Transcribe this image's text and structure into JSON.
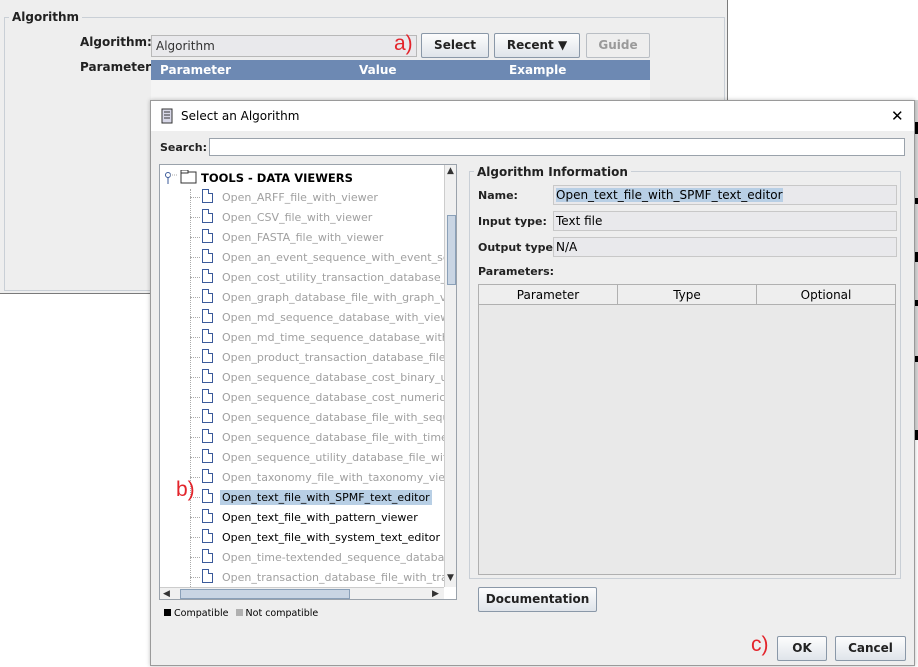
{
  "background_window": {
    "group_title": "Algorithm",
    "algorithm_label": "Algorithm:",
    "algorithm_value": "Algorithm",
    "parameters_label": "Parameters:",
    "select_button": "Select",
    "recent_button": "Recent",
    "guide_button": "Guide",
    "table_headers": [
      "Parameter",
      "Value",
      "Example"
    ]
  },
  "annotations": {
    "a": "a)",
    "b": "b)",
    "c": "c)"
  },
  "dialog": {
    "title": "Select an Algorithm",
    "close_glyph": "✕",
    "search_label": "Search:",
    "search_value": "",
    "tree": {
      "root_label": "TOOLS - DATA VIEWERS",
      "items": [
        {
          "label": "Open_ARFF_file_with_viewer",
          "compatible": false,
          "selected": false
        },
        {
          "label": "Open_CSV_file_with_viewer",
          "compatible": false,
          "selected": false
        },
        {
          "label": "Open_FASTA_file_with_viewer",
          "compatible": false,
          "selected": false
        },
        {
          "label": "Open_an_event_sequence_with_event_seque",
          "compatible": false,
          "selected": false
        },
        {
          "label": "Open_cost_utility_transaction_database_file_",
          "compatible": false,
          "selected": false
        },
        {
          "label": "Open_graph_database_file_with_graph_viewe",
          "compatible": false,
          "selected": false
        },
        {
          "label": "Open_md_sequence_database_with_viewer",
          "compatible": false,
          "selected": false
        },
        {
          "label": "Open_md_time_sequence_database_with_vie",
          "compatible": false,
          "selected": false
        },
        {
          "label": "Open_product_transaction_database_file_witl",
          "compatible": false,
          "selected": false
        },
        {
          "label": "Open_sequence_database_cost_binary_utility",
          "compatible": false,
          "selected": false
        },
        {
          "label": "Open_sequence_database_cost_numeric_utili",
          "compatible": false,
          "selected": false
        },
        {
          "label": "Open_sequence_database_file_with_sequenc",
          "compatible": false,
          "selected": false
        },
        {
          "label": "Open_sequence_database_file_with_time_inte",
          "compatible": false,
          "selected": false
        },
        {
          "label": "Open_sequence_utility_database_file_with_se",
          "compatible": false,
          "selected": false
        },
        {
          "label": "Open_taxonomy_file_with_taxonomy_viewer",
          "compatible": false,
          "selected": false
        },
        {
          "label": "Open_text_file_with_SPMF_text_editor",
          "compatible": true,
          "selected": true
        },
        {
          "label": "Open_text_file_with_pattern_viewer",
          "compatible": true,
          "selected": false
        },
        {
          "label": "Open_text_file_with_system_text_editor",
          "compatible": true,
          "selected": false
        },
        {
          "label": "Open_time-textended_sequence_database_w",
          "compatible": false,
          "selected": false
        },
        {
          "label": "Open_transaction_database_file_with_transa",
          "compatible": false,
          "selected": false
        }
      ]
    },
    "legend": {
      "compatible": "Compatible",
      "not_compatible": "Not compatible"
    },
    "info": {
      "group_title": "Algorithm Information",
      "name_label": "Name:",
      "name_value": "Open_text_file_with_SPMF_text_editor",
      "input_type_label": "Input type:",
      "input_type_value": "Text file",
      "output_type_label": "Output type:",
      "output_type_value": "N/A",
      "parameters_label": "Parameters:",
      "table_headers": [
        "Parameter",
        "Type",
        "Optional"
      ]
    },
    "documentation_button": "Documentation",
    "ok_button": "OK",
    "cancel_button": "Cancel"
  },
  "colors": {
    "accent": "#6d89b3",
    "selection": "#b8cfe5",
    "annotation": "#e3242b",
    "incompatible_text": "#a0a0a0"
  }
}
